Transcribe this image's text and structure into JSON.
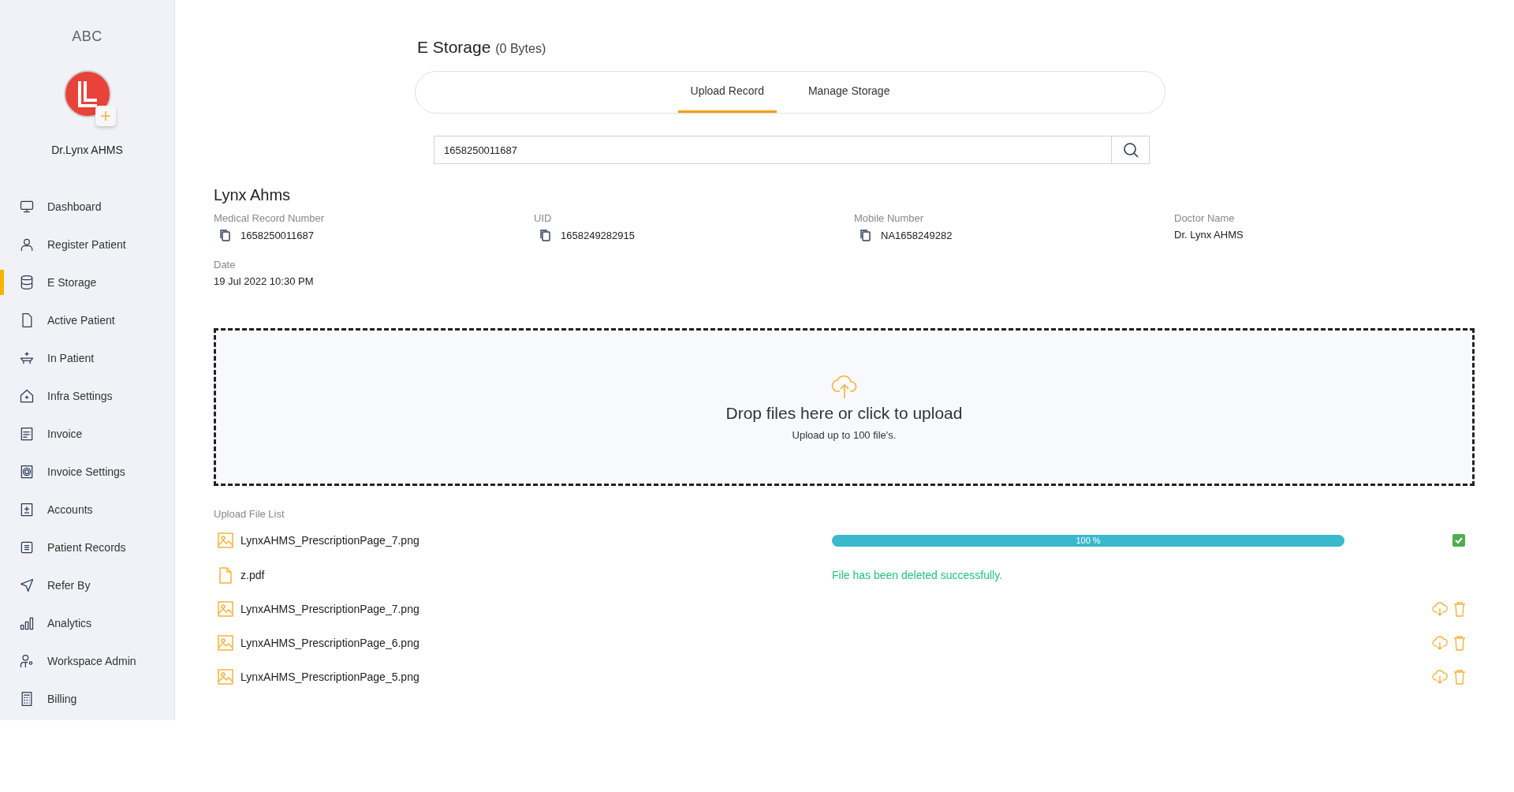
{
  "sidebar": {
    "org": "ABC",
    "user_name": "Dr.Lynx AHMS",
    "items": [
      {
        "label": "Dashboard",
        "selected": false
      },
      {
        "label": "Register Patient",
        "selected": false
      },
      {
        "label": "E Storage",
        "selected": true
      },
      {
        "label": "Active Patient",
        "selected": false
      },
      {
        "label": "In Patient",
        "selected": false
      },
      {
        "label": "Infra Settings",
        "selected": false
      },
      {
        "label": "Invoice",
        "selected": false
      },
      {
        "label": "Invoice Settings",
        "selected": false
      },
      {
        "label": "Accounts",
        "selected": false
      },
      {
        "label": "Patient Records",
        "selected": false
      },
      {
        "label": "Refer By",
        "selected": false
      },
      {
        "label": "Analytics",
        "selected": false
      },
      {
        "label": "Workspace Admin",
        "selected": false
      },
      {
        "label": "Billing",
        "selected": false
      }
    ]
  },
  "page": {
    "title": "E Storage",
    "size": "(0 Bytes)"
  },
  "tabs": [
    {
      "label": "Upload Record",
      "selected": true
    },
    {
      "label": "Manage Storage",
      "selected": false
    }
  ],
  "search": {
    "value": "1658250011687"
  },
  "patient": {
    "name": "Lynx Ahms",
    "fields": [
      {
        "label": "Medical Record Number",
        "value": "1658250011687",
        "copyable": true
      },
      {
        "label": "UID",
        "value": "1658249282915",
        "copyable": true
      },
      {
        "label": "Mobile Number",
        "value": "NA1658249282",
        "copyable": true
      },
      {
        "label": "Doctor Name",
        "value": "Dr. Lynx AHMS",
        "copyable": false
      },
      {
        "label": "Date",
        "value": "19 Jul 2022 10:30 PM",
        "copyable": false
      }
    ]
  },
  "dropzone": {
    "title": "Drop files here or click to upload",
    "hint": "Upload up to 100 file's."
  },
  "file_list": {
    "label": "Upload File List",
    "files": [
      {
        "name": "LynxAHMS_PrescriptionPage_7.png",
        "kind": "image",
        "level": 1,
        "reading": "100 %",
        "done": true
      },
      {
        "name": "z.pdf",
        "kind": "document",
        "message": "File has been deleted successfully."
      },
      {
        "name": "LynxAHMS_PrescriptionPage_7.png",
        "kind": "image"
      },
      {
        "name": "LynxAHMS_PrescriptionPage_6.png",
        "kind": "image"
      },
      {
        "name": "LynxAHMS_PrescriptionPage_5.png",
        "kind": "image"
      }
    ]
  }
}
